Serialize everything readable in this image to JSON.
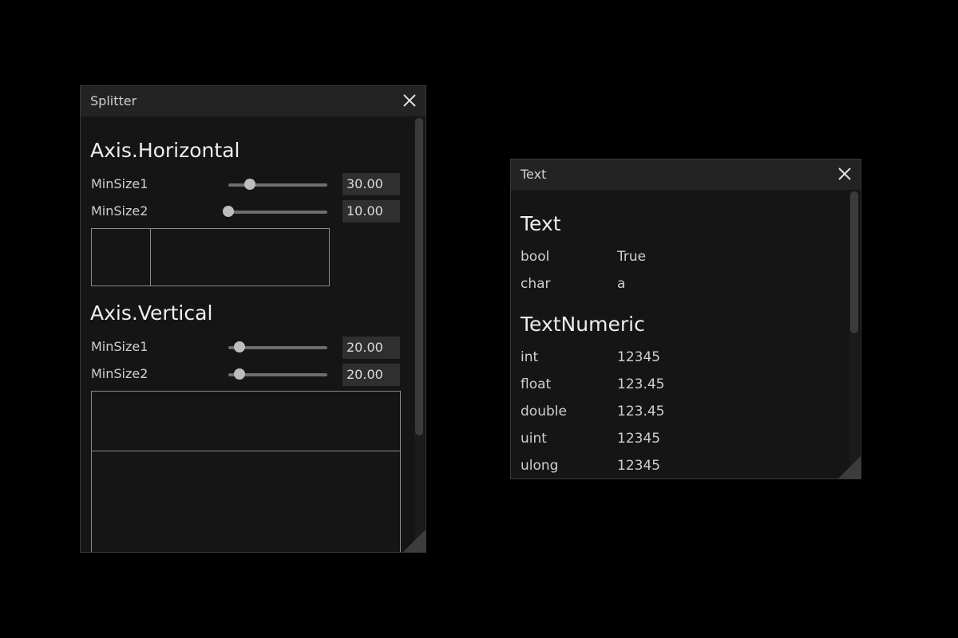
{
  "splitter_window": {
    "title": "Splitter",
    "horizontal": {
      "heading": "Axis.Horizontal",
      "min_size1": {
        "label": "MinSize1",
        "value": "30.00",
        "fraction": 0.22
      },
      "min_size2": {
        "label": "MinSize2",
        "value": "10.00",
        "fraction": 0.0
      }
    },
    "vertical": {
      "heading": "Axis.Vertical",
      "min_size1": {
        "label": "MinSize1",
        "value": "20.00",
        "fraction": 0.11
      },
      "min_size2": {
        "label": "MinSize2",
        "value": "20.00",
        "fraction": 0.11
      }
    }
  },
  "text_window": {
    "title": "Text",
    "sections": [
      {
        "heading": "Text",
        "rows": [
          {
            "key": "bool",
            "value": "True"
          },
          {
            "key": "char",
            "value": "a"
          }
        ]
      },
      {
        "heading": "TextNumeric",
        "rows": [
          {
            "key": "int",
            "value": "12345"
          },
          {
            "key": "float",
            "value": "123.45"
          },
          {
            "key": "double",
            "value": "123.45"
          },
          {
            "key": "uint",
            "value": "12345"
          },
          {
            "key": "ulong",
            "value": "12345"
          }
        ]
      }
    ]
  },
  "icons": {
    "close": "close-icon",
    "resize": "resize-grip-icon"
  }
}
